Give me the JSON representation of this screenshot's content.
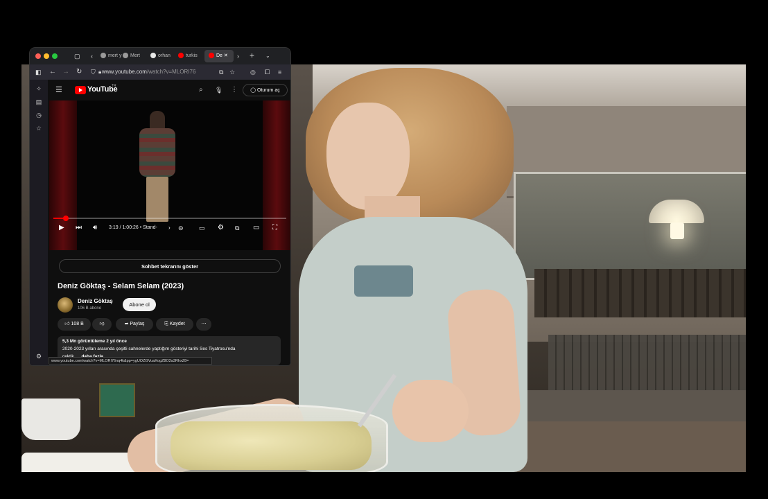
{
  "browser": {
    "tabs": [
      {
        "label": "mert y",
        "favicon_color": "#9a9a9a"
      },
      {
        "label": "Mert",
        "favicon_color": "#9a9a9a"
      },
      {
        "label": "orhan",
        "favicon_color": "#e8e8e8"
      },
      {
        "label": "turkis",
        "favicon_color": "#ff0000"
      },
      {
        "label": "De",
        "favicon_color": "#ff0000"
      }
    ],
    "url_host": "www.youtube.com",
    "url_path": "/watch?v=MLORI76",
    "status_url": "www.youtube.com/watch?v=MLORI76nq4k&pp=ygUOZGVuaXogZ8O2a3RhxZ8="
  },
  "youtube": {
    "logo": "YouTube",
    "logo_region": "TR",
    "signin_label": "Oturum aç",
    "player": {
      "time": "3:19 / 1:00:26",
      "chapter": "Stand-",
      "progress_fraction": 0.055
    },
    "chat_replay_label": "Sohbet tekrarını göster",
    "video_title": "Deniz Göktaş - Selam Selam (2023)",
    "channel_name": "Deniz Göktaş",
    "subscribers": "106 B abone",
    "subscribe_label": "Abone ol",
    "like_count": "108 B",
    "share_label": "Paylaş",
    "save_label": "Kaydet",
    "description": {
      "meta": "5,3 Mn görüntüleme  2 yıl önce",
      "line1": "2020-2023 yılları arasında çeşitli sahnelerde yaptığım gösteriyi tarihi Ses Tiyatrosu'nda",
      "line2": "çektik.",
      "more": "...daha fazla"
    }
  }
}
